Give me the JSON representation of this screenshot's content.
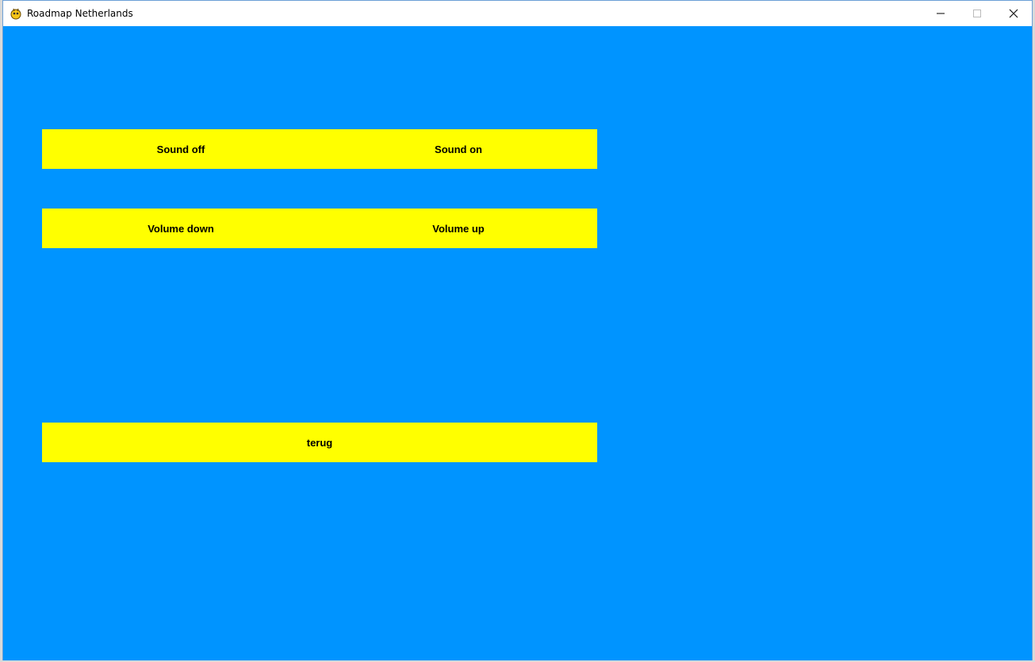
{
  "window": {
    "title": "Roadmap Netherlands",
    "app_icon": "pygame-snake-icon"
  },
  "colors": {
    "background": "#0094ff",
    "button": "#ffff00",
    "text": "#000000"
  },
  "sound_row": {
    "off_label": "Sound off",
    "on_label": "Sound on"
  },
  "volume_row": {
    "down_label": "Volume down",
    "up_label": "Volume up"
  },
  "back": {
    "label": "terug"
  }
}
